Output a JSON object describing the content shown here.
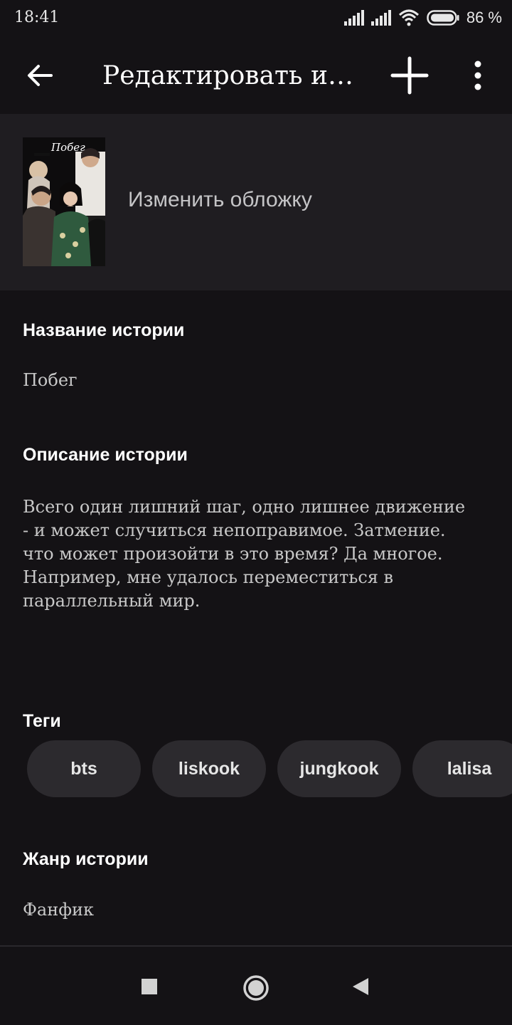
{
  "status_bar": {
    "time": "18:41",
    "battery": "86 %",
    "icons": [
      "signal-icon",
      "signal-icon",
      "wifi-icon",
      "battery-icon"
    ]
  },
  "appbar": {
    "title": "Редактировать ис...",
    "icons": {
      "back": "arrow-left-icon",
      "add": "plus-icon",
      "more": "more-vert-icon"
    }
  },
  "cover": {
    "image_title": "Побег",
    "change_label": "Изменить обложку"
  },
  "story": {
    "title_label": "Название истории",
    "title_value": "Побег",
    "description_label": "Описание истории",
    "description_lines": [
      "Всего один лишний шаг, одно лишнее движение",
      "- и может случиться непоправимое. Затмение.",
      "что может произойти в это время? Да многое.",
      "Например, мне удалось переместиться в",
      "параллельный мир."
    ],
    "tags_label": "Теги",
    "tags": [
      "bts",
      "liskook",
      "jungkook",
      "lalisa"
    ],
    "genre_label": "Жанр истории",
    "genre_value": "Фанфик"
  },
  "navbar": {
    "icons": [
      "recents-square-icon",
      "home-circle-icon",
      "back-triangle-icon"
    ]
  },
  "colors": {
    "background": "#141215",
    "cover_section": "#1f1d21",
    "chip": "#2c2a2e",
    "muted_text": "#c8c8c8"
  }
}
